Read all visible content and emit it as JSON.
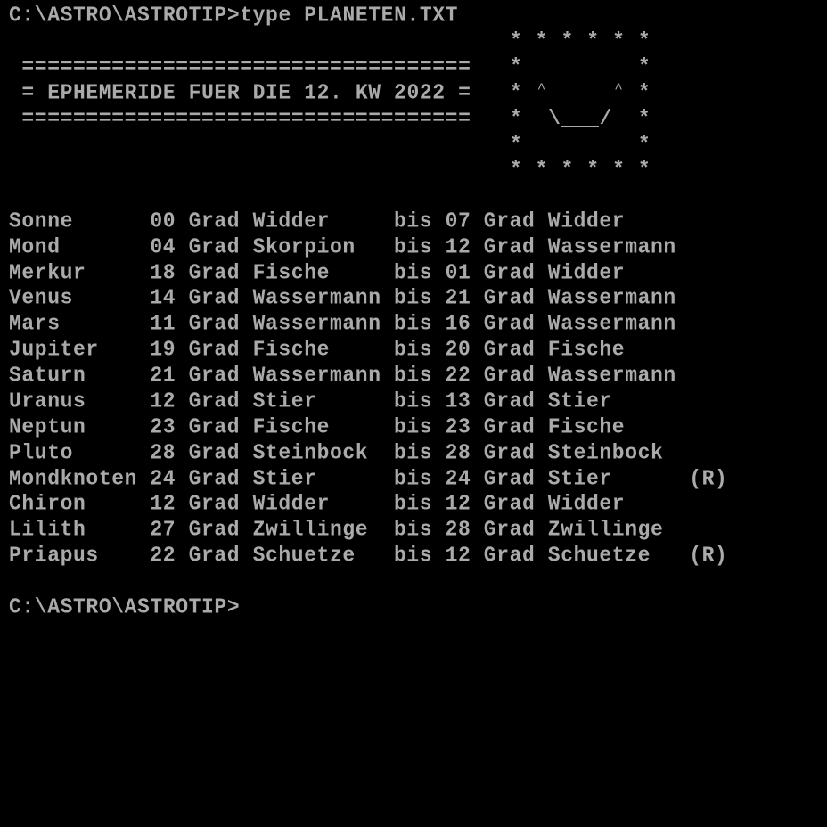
{
  "terminal": {
    "prompt": "C:\\ASTRO\\ASTROTIP>",
    "command_line": "C:\\ASTRO\\ASTROTIP>type PLANETEN.TXT",
    "final_prompt": "C:\\ASTRO\\ASTROTIP>"
  },
  "banner": {
    "border": "===================================",
    "title": "= EPHEMERIDE FUER DIE 12. KW 2022 ="
  },
  "smiley": {
    "star": "*",
    "eye": "^",
    "mouth_left": "\\",
    "mouth_right": "/"
  },
  "ephemeris": {
    "connector": "bis",
    "unit": "Grad",
    "retrograde_marker": "(R)",
    "rows": [
      {
        "body": "Sonne",
        "from_deg": "00",
        "from_sign": "Widder",
        "to_deg": "07",
        "to_sign": "Widder",
        "retro": ""
      },
      {
        "body": "Mond",
        "from_deg": "04",
        "from_sign": "Skorpion",
        "to_deg": "12",
        "to_sign": "Wassermann",
        "retro": ""
      },
      {
        "body": "Merkur",
        "from_deg": "18",
        "from_sign": "Fische",
        "to_deg": "01",
        "to_sign": "Widder",
        "retro": ""
      },
      {
        "body": "Venus",
        "from_deg": "14",
        "from_sign": "Wassermann",
        "to_deg": "21",
        "to_sign": "Wassermann",
        "retro": ""
      },
      {
        "body": "Mars",
        "from_deg": "11",
        "from_sign": "Wassermann",
        "to_deg": "16",
        "to_sign": "Wassermann",
        "retro": ""
      },
      {
        "body": "Jupiter",
        "from_deg": "19",
        "from_sign": "Fische",
        "to_deg": "20",
        "to_sign": "Fische",
        "retro": ""
      },
      {
        "body": "Saturn",
        "from_deg": "21",
        "from_sign": "Wassermann",
        "to_deg": "22",
        "to_sign": "Wassermann",
        "retro": ""
      },
      {
        "body": "Uranus",
        "from_deg": "12",
        "from_sign": "Stier",
        "to_deg": "13",
        "to_sign": "Stier",
        "retro": ""
      },
      {
        "body": "Neptun",
        "from_deg": "23",
        "from_sign": "Fische",
        "to_deg": "23",
        "to_sign": "Fische",
        "retro": ""
      },
      {
        "body": "Pluto",
        "from_deg": "28",
        "from_sign": "Steinbock",
        "to_deg": "28",
        "to_sign": "Steinbock",
        "retro": ""
      },
      {
        "body": "Mondknoten",
        "from_deg": "24",
        "from_sign": "Stier",
        "to_deg": "24",
        "to_sign": "Stier",
        "retro": "(R)"
      },
      {
        "body": "Chiron",
        "from_deg": "12",
        "from_sign": "Widder",
        "to_deg": "12",
        "to_sign": "Widder",
        "retro": ""
      },
      {
        "body": "Lilith",
        "from_deg": "27",
        "from_sign": "Zwillinge",
        "to_deg": "28",
        "to_sign": "Zwillinge",
        "retro": ""
      },
      {
        "body": "Priapus",
        "from_deg": "22",
        "from_sign": "Schuetze",
        "to_deg": "12",
        "to_sign": "Schuetze",
        "retro": "(R)"
      }
    ]
  },
  "colors": {
    "background": "#000000",
    "text": "#aaaaaa"
  }
}
